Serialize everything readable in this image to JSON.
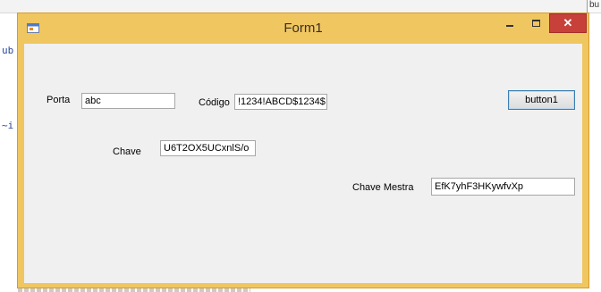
{
  "background": {
    "tab_fragment": "bu",
    "code_fragment_1": "ub",
    "code_fragment_2": "~i"
  },
  "window": {
    "title": "Form1",
    "close_glyph": "✕"
  },
  "form": {
    "porta_label": "Porta",
    "porta_value": "abc",
    "codigo_label": "Código",
    "codigo_value": "!1234!ABCD$1234$",
    "button_label": "button1",
    "chave_label": "Chave",
    "chave_value": "U6T2OX5UCxnlS/o",
    "chave_mestra_label": "Chave Mestra",
    "chave_mestra_value": "EfK7yhF3HKywfvXp"
  },
  "colors": {
    "title_bar": "#f0c660",
    "close_button": "#c7403a",
    "client_area": "#f0f0f0"
  },
  "icons": [
    "app-icon",
    "minimize-icon",
    "maximize-icon",
    "close-icon"
  ]
}
